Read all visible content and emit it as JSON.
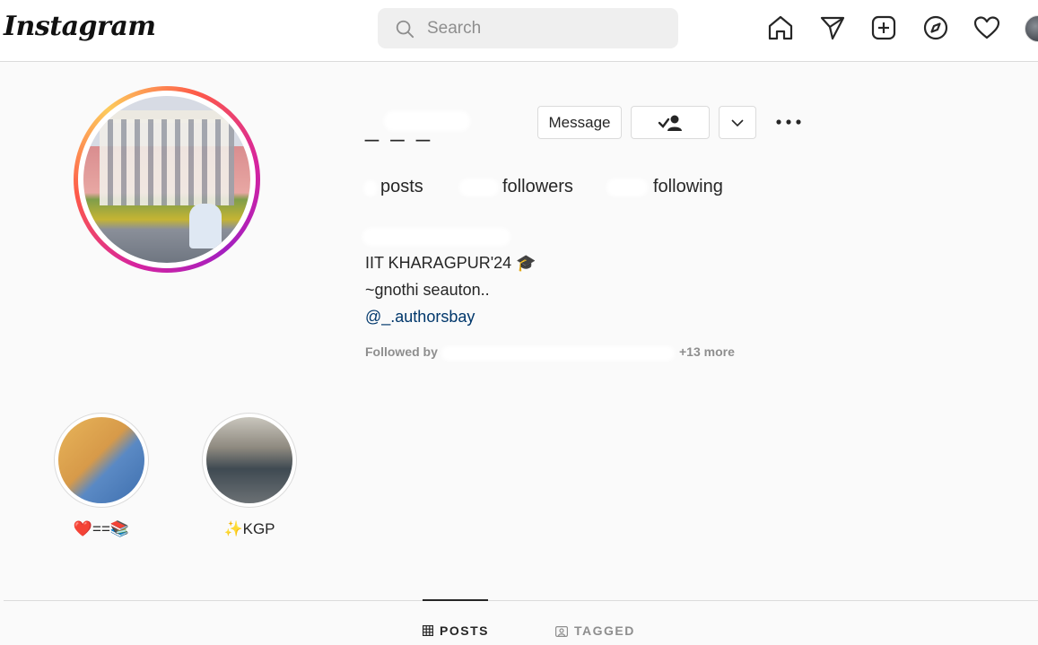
{
  "header": {
    "logo": "Instagram",
    "search_placeholder": "Search"
  },
  "nav_icons": [
    "home-icon",
    "direct-icon",
    "new-post-icon",
    "explore-icon",
    "activity-heart-icon",
    "profile-avatar"
  ],
  "profile": {
    "username": "_ _ _",
    "buttons": {
      "message": "Message",
      "follow_icon": "following-check-user-icon",
      "dropdown_icon": "chevron-down-icon",
      "more_icon": "more-dots-icon"
    },
    "stats": {
      "posts_label": "posts",
      "followers_label": "followers",
      "following_label": "following"
    },
    "bio": {
      "line1": "IIT KHARAGPUR'24 🎓",
      "line2": "~gnothi seauton..",
      "link": "@_.authorsbay"
    },
    "followed_by": {
      "prefix": "Followed by",
      "more": "+13 more"
    }
  },
  "highlights": [
    {
      "label": "❤️==📚"
    },
    {
      "label": "✨KGP"
    }
  ],
  "tabs": [
    {
      "label": "POSTS",
      "icon": "grid-icon",
      "active": true
    },
    {
      "label": "TAGGED",
      "icon": "tagged-icon",
      "active": false
    }
  ],
  "colors": {
    "text": "#262626",
    "secondary": "#8e8e8e",
    "link": "#00376b",
    "border": "#dbdbdb"
  }
}
